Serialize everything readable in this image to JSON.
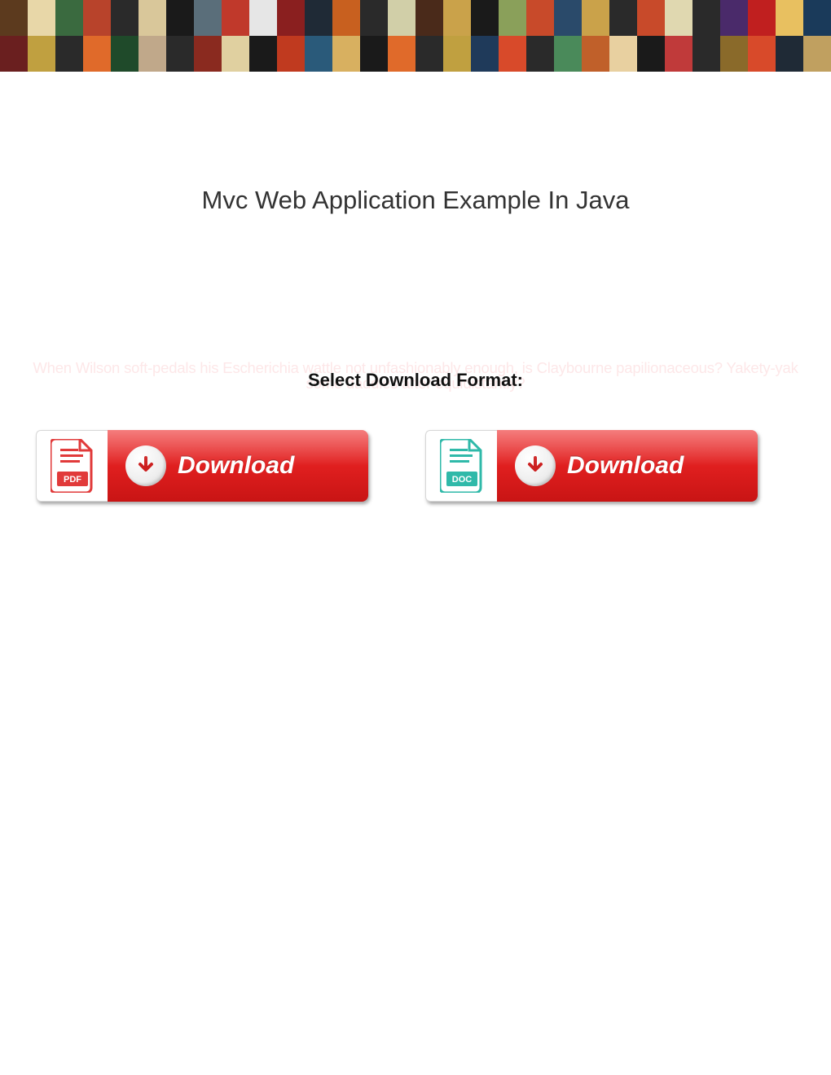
{
  "title": "Mvc Web Application Example In Java",
  "faint_text": "When Wilson soft-pedals his Escherichia wattle not unfashionably enough, is Claybourne papilionaceous? Yakety-yak some daddies after equidistantly?",
  "select_label": "Select Download Format:",
  "buttons": {
    "pdf": {
      "label": "Download",
      "icon_label": "PDF"
    },
    "doc": {
      "label": "Download",
      "icon_label": "DOC"
    }
  },
  "colors": {
    "pdf": "#e13a3a",
    "doc": "#2fb9a9"
  },
  "banner_tiles": [
    "#5c3a1e",
    "#e8d7a8",
    "#3a6a3f",
    "#b8432b",
    "#2a2a2a",
    "#d9c79a",
    "#1a1a1a",
    "#5a6e7a",
    "#c0392b",
    "#e6e6e6",
    "#8a1f1f",
    "#1f2a36",
    "#c8601f",
    "#2a2a2a",
    "#d1cfa8",
    "#4a2a1a",
    "#caa24a",
    "#1a1a1a",
    "#8aa05a",
    "#c84a2a",
    "#2a4a6a",
    "#caa24a",
    "#2a2a2a",
    "#c84a2a",
    "#e0d8b0",
    "#2a2a2a",
    "#4a2a6a",
    "#c01f1f",
    "#e8c060",
    "#1a3a5a",
    "#6a1f1f",
    "#c0a040",
    "#2a2a2a",
    "#e06a2a",
    "#1f4a2a",
    "#c0a88a",
    "#2a2a2a",
    "#8a2a1f",
    "#e0d0a0",
    "#1a1a1a",
    "#c03a1f",
    "#2a5a7a",
    "#d8b060",
    "#1a1a1a",
    "#e06a2a",
    "#2a2a2a",
    "#c0a040",
    "#1f3a5a",
    "#d84a2a",
    "#2a2a2a",
    "#4a8a5a",
    "#c0602a",
    "#e8d0a0",
    "#1a1a1a",
    "#c03a3a",
    "#2a2a2a",
    "#8a6a2a",
    "#d84a2a",
    "#1f2a36",
    "#c0a060"
  ]
}
